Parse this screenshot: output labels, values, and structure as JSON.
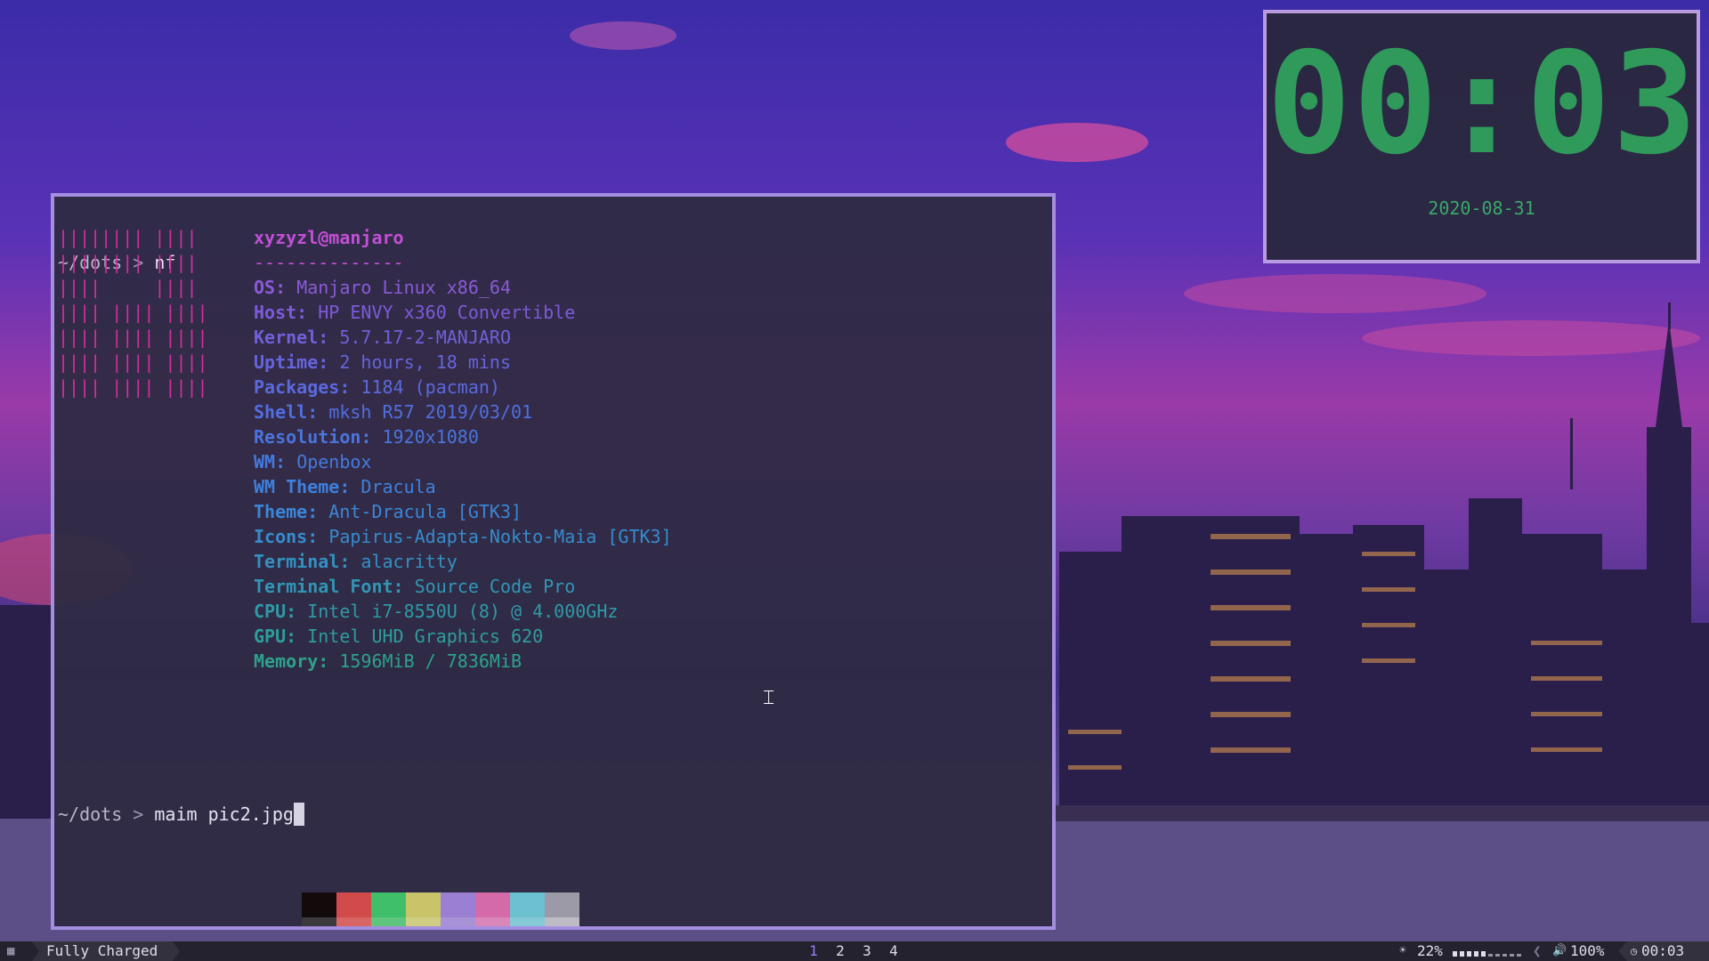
{
  "terminal": {
    "prompt_path": "~/dots",
    "prompt_sep": ">",
    "first_command": "nf",
    "second_command": "maim pic2.jpg",
    "user_host": "xyzyzl@manjaro",
    "separator": "--------------",
    "logo_lines": [
      "|||||||| ||||",
      "|||||||| ||||",
      "||||     ||||",
      "|||| |||| ||||",
      "|||| |||| ||||",
      "|||| |||| ||||",
      "|||| |||| ||||"
    ],
    "info": [
      {
        "key": "OS",
        "value": "Manjaro Linux x86_64",
        "color": "#8a5ad6"
      },
      {
        "key": "Host",
        "value": "HP ENVY x360 Convertible",
        "color": "#7d5ad9"
      },
      {
        "key": "Kernel",
        "value": "5.7.17-2-MANJARO",
        "color": "#7060da"
      },
      {
        "key": "Uptime",
        "value": "2 hours, 18 mins",
        "color": "#6465dc"
      },
      {
        "key": "Packages",
        "value": "1184 (pacman)",
        "color": "#5a69dd"
      },
      {
        "key": "Shell",
        "value": "mksh R57 2019/03/01",
        "color": "#516ede"
      },
      {
        "key": "Resolution",
        "value": "1920x1080",
        "color": "#4a74de"
      },
      {
        "key": "WM",
        "value": "Openbox",
        "color": "#437ade"
      },
      {
        "key": "WM Theme",
        "value": "Dracula",
        "color": "#3e80dc"
      },
      {
        "key": "Theme",
        "value": "Ant-Dracula [GTK3]",
        "color": "#3a86d6"
      },
      {
        "key": "Icons",
        "value": "Papirus-Adapta-Nokto-Maia [GTK3]",
        "color": "#368ccd"
      },
      {
        "key": "Terminal",
        "value": "alacritty",
        "color": "#3391c2"
      },
      {
        "key": "Terminal Font",
        "value": "Source Code Pro",
        "color": "#3096b5"
      },
      {
        "key": "CPU",
        "value": "Intel i7-8550U (8) @ 4.000GHz",
        "color": "#2e9aa8"
      },
      {
        "key": "GPU",
        "value": "Intel UHD Graphics 620",
        "color": "#2d9e9a"
      },
      {
        "key": "Memory",
        "value": "1596MiB / 7836MiB",
        "color": "#2ca28c"
      }
    ],
    "palette_top": [
      "#130b0b",
      "#d24b4b",
      "#3fbf6a",
      "#c9c46a",
      "#9b7fd3",
      "#d46aa8",
      "#6cc0cf",
      "#9c9aa6"
    ],
    "palette_bottom": [
      "#3a3a3c",
      "#d96464",
      "#5fc47e",
      "#d0cc82",
      "#a993d8",
      "#d987b8",
      "#86c9d6",
      "#bdbbc4"
    ]
  },
  "clock_widget": {
    "time": "00:03",
    "date": "2020-08-31",
    "color": "#2f9a5a"
  },
  "bar": {
    "battery_status": "Fully Charged",
    "workspaces": [
      "1",
      "2",
      "3",
      "4"
    ],
    "active_workspace": "1",
    "brightness": "22%",
    "brightness_level": 0.22,
    "volume": "100%",
    "time": "00:03"
  },
  "colors": {
    "accent_border": "#a48ee0",
    "bar_bg": "#24222f"
  }
}
